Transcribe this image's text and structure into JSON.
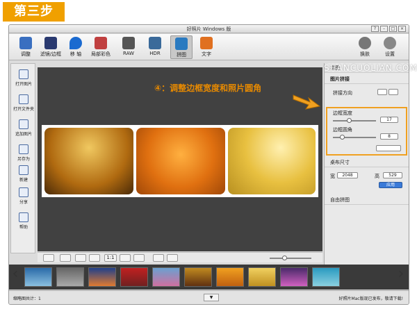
{
  "step_banner": "第三步",
  "annotation": "④：调整边框宽度和照片圆角",
  "watermark": "SHANCUOLIAN.COM",
  "window": {
    "title": "好照片 Windows 版",
    "controls": [
      "?",
      "–",
      "□",
      "×"
    ]
  },
  "toolbar": {
    "items": [
      {
        "label": "调整",
        "icon": "adjust-icon",
        "color": "#3a6fc0"
      },
      {
        "label": "滤镜/边框",
        "icon": "filter-icon",
        "color": "#2a3a70"
      },
      {
        "label": "移 轴",
        "icon": "tiltshift-icon",
        "color": "#1a6ad0"
      },
      {
        "label": "局部彩色",
        "icon": "local-color-icon",
        "color": "#c04040"
      },
      {
        "label": "RAW",
        "icon": "raw-icon",
        "color": "#555555"
      },
      {
        "label": "HDR",
        "icon": "hdr-icon",
        "color": "#3a6a9a"
      },
      {
        "label": "拼图",
        "icon": "collage-icon",
        "color": "#2a7ac0"
      },
      {
        "label": "文字",
        "icon": "text-icon",
        "color": "#e07020"
      }
    ],
    "right": [
      {
        "label": "换肤",
        "icon": "skin-icon"
      },
      {
        "label": "设置",
        "icon": "gear-icon"
      }
    ]
  },
  "leftbar": [
    "打开图片",
    "打开文件夹",
    "追加图片",
    "另存为",
    "新建",
    "分享",
    "帮助"
  ],
  "panel": {
    "header": "拼图",
    "section_collage": "图片拼接",
    "direction_label": "拼接方向",
    "border_width_label": "边框宽度",
    "border_width_value": "17",
    "corner_radius_label": "边框圆角",
    "corner_radius_value": "8",
    "canvas_size": "桌布尺寸",
    "width_label": "宽",
    "width_value": "2048",
    "height_label": "高",
    "height_value": "529",
    "apply_button": "应用",
    "free_collage": "自由拼图"
  },
  "canvas_tools": [
    "1:1"
  ],
  "status": {
    "left": "缩略图共计：1",
    "right": "好照片Mac版现已发布，敬请下载!"
  },
  "colors": {
    "accent": "#f0a000",
    "canvas": "#414141"
  }
}
